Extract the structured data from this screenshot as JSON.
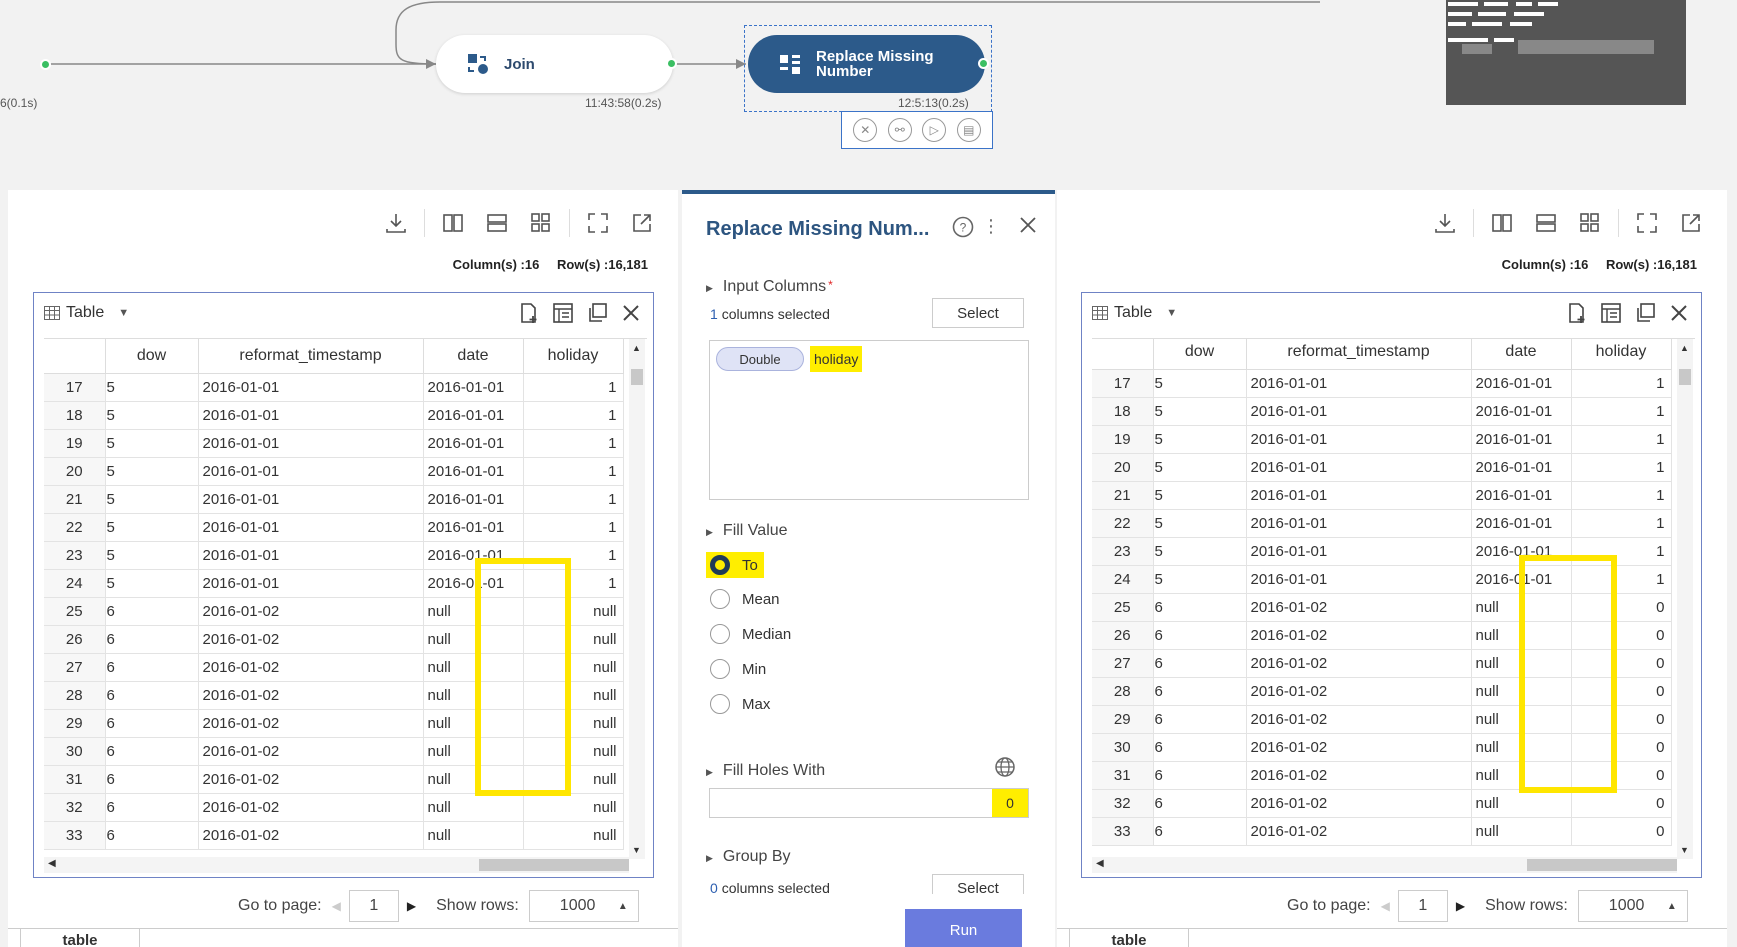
{
  "canvas": {
    "partial_time": "6(0.1s)",
    "join_node": {
      "label": "Join",
      "time": "11:43:58(0.2s)"
    },
    "replace_node": {
      "label_line1": "Replace Missing",
      "label_line2": "Number",
      "time": "12:5:13(0.2s)"
    }
  },
  "left_panel": {
    "stats": {
      "columns": "Column(s) :16",
      "rows": "Row(s) :16,181"
    },
    "table_label": "Table",
    "headers": [
      "dow",
      "reformat_timestamp",
      "date",
      "holiday"
    ],
    "rows": [
      {
        "n": "17",
        "dow": "5",
        "ts": "2016-01-01",
        "date": "2016-01-01",
        "hol": "1"
      },
      {
        "n": "18",
        "dow": "5",
        "ts": "2016-01-01",
        "date": "2016-01-01",
        "hol": "1"
      },
      {
        "n": "19",
        "dow": "5",
        "ts": "2016-01-01",
        "date": "2016-01-01",
        "hol": "1"
      },
      {
        "n": "20",
        "dow": "5",
        "ts": "2016-01-01",
        "date": "2016-01-01",
        "hol": "1"
      },
      {
        "n": "21",
        "dow": "5",
        "ts": "2016-01-01",
        "date": "2016-01-01",
        "hol": "1"
      },
      {
        "n": "22",
        "dow": "5",
        "ts": "2016-01-01",
        "date": "2016-01-01",
        "hol": "1"
      },
      {
        "n": "23",
        "dow": "5",
        "ts": "2016-01-01",
        "date": "2016-01-01",
        "hol": "1"
      },
      {
        "n": "24",
        "dow": "5",
        "ts": "2016-01-01",
        "date": "2016-01-01",
        "hol": "1"
      },
      {
        "n": "25",
        "dow": "6",
        "ts": "2016-01-02",
        "date": "null",
        "hol": "null"
      },
      {
        "n": "26",
        "dow": "6",
        "ts": "2016-01-02",
        "date": "null",
        "hol": "null"
      },
      {
        "n": "27",
        "dow": "6",
        "ts": "2016-01-02",
        "date": "null",
        "hol": "null"
      },
      {
        "n": "28",
        "dow": "6",
        "ts": "2016-01-02",
        "date": "null",
        "hol": "null"
      },
      {
        "n": "29",
        "dow": "6",
        "ts": "2016-01-02",
        "date": "null",
        "hol": "null"
      },
      {
        "n": "30",
        "dow": "6",
        "ts": "2016-01-02",
        "date": "null",
        "hol": "null"
      },
      {
        "n": "31",
        "dow": "6",
        "ts": "2016-01-02",
        "date": "null",
        "hol": "null"
      },
      {
        "n": "32",
        "dow": "6",
        "ts": "2016-01-02",
        "date": "null",
        "hol": "null"
      },
      {
        "n": "33",
        "dow": "6",
        "ts": "2016-01-02",
        "date": "null",
        "hol": "null"
      }
    ],
    "pager": {
      "goto_label": "Go to page:",
      "page": "1",
      "rows_label": "Show rows:",
      "rows_value": "1000"
    },
    "tab": "table"
  },
  "right_panel": {
    "stats": {
      "columns": "Column(s) :16",
      "rows": "Row(s) :16,181"
    },
    "table_label": "Table",
    "headers": [
      "dow",
      "reformat_timestamp",
      "date",
      "holiday"
    ],
    "rows": [
      {
        "n": "17",
        "dow": "5",
        "ts": "2016-01-01",
        "date": "2016-01-01",
        "hol": "1"
      },
      {
        "n": "18",
        "dow": "5",
        "ts": "2016-01-01",
        "date": "2016-01-01",
        "hol": "1"
      },
      {
        "n": "19",
        "dow": "5",
        "ts": "2016-01-01",
        "date": "2016-01-01",
        "hol": "1"
      },
      {
        "n": "20",
        "dow": "5",
        "ts": "2016-01-01",
        "date": "2016-01-01",
        "hol": "1"
      },
      {
        "n": "21",
        "dow": "5",
        "ts": "2016-01-01",
        "date": "2016-01-01",
        "hol": "1"
      },
      {
        "n": "22",
        "dow": "5",
        "ts": "2016-01-01",
        "date": "2016-01-01",
        "hol": "1"
      },
      {
        "n": "23",
        "dow": "5",
        "ts": "2016-01-01",
        "date": "2016-01-01",
        "hol": "1"
      },
      {
        "n": "24",
        "dow": "5",
        "ts": "2016-01-01",
        "date": "2016-01-01",
        "hol": "1"
      },
      {
        "n": "25",
        "dow": "6",
        "ts": "2016-01-02",
        "date": "null",
        "hol": "0"
      },
      {
        "n": "26",
        "dow": "6",
        "ts": "2016-01-02",
        "date": "null",
        "hol": "0"
      },
      {
        "n": "27",
        "dow": "6",
        "ts": "2016-01-02",
        "date": "null",
        "hol": "0"
      },
      {
        "n": "28",
        "dow": "6",
        "ts": "2016-01-02",
        "date": "null",
        "hol": "0"
      },
      {
        "n": "29",
        "dow": "6",
        "ts": "2016-01-02",
        "date": "null",
        "hol": "0"
      },
      {
        "n": "30",
        "dow": "6",
        "ts": "2016-01-02",
        "date": "null",
        "hol": "0"
      },
      {
        "n": "31",
        "dow": "6",
        "ts": "2016-01-02",
        "date": "null",
        "hol": "0"
      },
      {
        "n": "32",
        "dow": "6",
        "ts": "2016-01-02",
        "date": "null",
        "hol": "0"
      },
      {
        "n": "33",
        "dow": "6",
        "ts": "2016-01-02",
        "date": "null",
        "hol": "0"
      }
    ],
    "pager": {
      "goto_label": "Go to page:",
      "page": "1",
      "rows_label": "Show rows:",
      "rows_value": "1000"
    },
    "tab": "table"
  },
  "config": {
    "title": "Replace Missing Num...",
    "input_columns": {
      "label": "Input Columns",
      "required_mark": "*",
      "count": "1",
      "count_suffix": "columns selected",
      "select_label": "Select",
      "chip_type": "Double",
      "chip_name": "holiday"
    },
    "fill_value": {
      "label": "Fill Value",
      "options": [
        "To",
        "Mean",
        "Median",
        "Min",
        "Max"
      ],
      "selected": "To"
    },
    "fill_holes": {
      "label": "Fill Holes With",
      "value": "0"
    },
    "group_by": {
      "label": "Group By",
      "count": "0",
      "count_suffix": "columns selected",
      "select_label": "Select"
    },
    "run_label": "Run"
  },
  "colors": {
    "accent": "#2c5a8a",
    "highlight": "#ffee00",
    "null": "#e02424",
    "run": "#6a7bde"
  }
}
